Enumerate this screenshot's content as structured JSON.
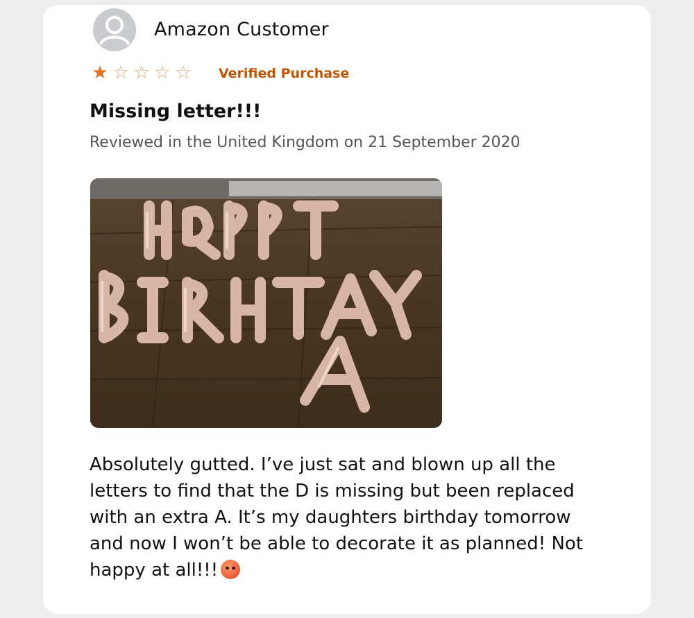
{
  "review": {
    "reviewer_name": "Amazon Customer",
    "rating": 1,
    "rating_max": 5,
    "verified_label": "Verified Purchase",
    "title": "Missing letter!!!",
    "meta": "Reviewed in the United Kingdom on 21 September 2020",
    "photo_icon": "balloon-photo",
    "body": "Absolutely gutted. I’ve just sat and blown up all the letters to find that the D is missing but been replaced with an extra A. It’s my daughters birthday tomorrow and now I won’t be able to decorate it as planned! Not happy at all!!!",
    "emoji_icon": "angry-face-emoji"
  },
  "colors": {
    "star": "#e7711b",
    "verified": "#c45500",
    "meta_text": "#555555"
  }
}
